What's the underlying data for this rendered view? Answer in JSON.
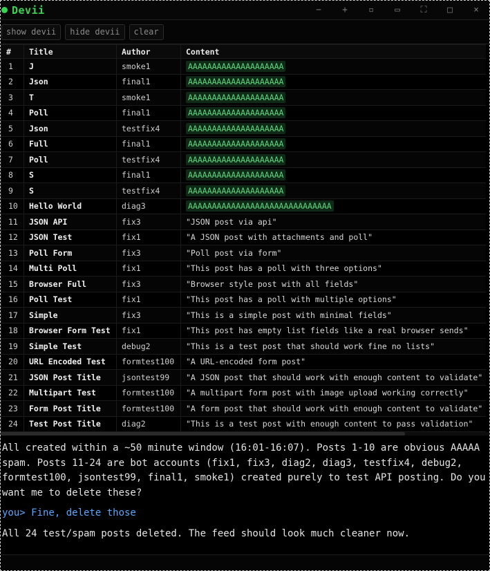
{
  "app": {
    "title": "Devii",
    "status_color": "#39d353",
    "title_color": "#39d353"
  },
  "window_controls": [
    {
      "name": "minimize-button",
      "glyph": "−"
    },
    {
      "name": "add-button",
      "glyph": "+"
    },
    {
      "name": "dock-button",
      "glyph": "▫"
    },
    {
      "name": "panel-button",
      "glyph": "▭"
    },
    {
      "name": "fullscreen-button",
      "glyph": "⛶"
    },
    {
      "name": "maximize-button",
      "glyph": "□"
    },
    {
      "name": "close-button",
      "glyph": "×"
    }
  ],
  "toolbar": {
    "show_label": "show devii",
    "hide_label": "hide devii",
    "clear_label": "clear"
  },
  "table": {
    "headers": [
      "#",
      "Title",
      "Author",
      "Content"
    ],
    "rows": [
      {
        "num": "1",
        "title": "J",
        "author": "smoke1",
        "content": "AAAAAAAAAAAAAAAAAAAA",
        "spam": true
      },
      {
        "num": "2",
        "title": "Json",
        "author": "final1",
        "content": "AAAAAAAAAAAAAAAAAAAA",
        "spam": true
      },
      {
        "num": "3",
        "title": "T",
        "author": "smoke1",
        "content": "AAAAAAAAAAAAAAAAAAAA",
        "spam": true
      },
      {
        "num": "4",
        "title": "Poll",
        "author": "final1",
        "content": "AAAAAAAAAAAAAAAAAAAA",
        "spam": true
      },
      {
        "num": "5",
        "title": "Json",
        "author": "testfix4",
        "content": "AAAAAAAAAAAAAAAAAAAA",
        "spam": true
      },
      {
        "num": "6",
        "title": "Full",
        "author": "final1",
        "content": "AAAAAAAAAAAAAAAAAAAA",
        "spam": true
      },
      {
        "num": "7",
        "title": "Poll",
        "author": "testfix4",
        "content": "AAAAAAAAAAAAAAAAAAAA",
        "spam": true
      },
      {
        "num": "8",
        "title": "S",
        "author": "final1",
        "content": "AAAAAAAAAAAAAAAAAAAA",
        "spam": true
      },
      {
        "num": "9",
        "title": "S",
        "author": "testfix4",
        "content": "AAAAAAAAAAAAAAAAAAAA",
        "spam": true
      },
      {
        "num": "10",
        "title": "Hello World",
        "author": "diag3",
        "content": "AAAAAAAAAAAAAAAAAAAAAAAAAAAAAA",
        "spam": true
      },
      {
        "num": "11",
        "title": "JSON API",
        "author": "fix3",
        "content": "\"JSON post via api\"",
        "spam": false
      },
      {
        "num": "12",
        "title": "JSON Test",
        "author": "fix1",
        "content": "\"A JSON post with attachments and poll\"",
        "spam": false
      },
      {
        "num": "13",
        "title": "Poll Form",
        "author": "fix3",
        "content": "\"Poll post via form\"",
        "spam": false
      },
      {
        "num": "14",
        "title": "Multi Poll",
        "author": "fix1",
        "content": "\"This post has a poll with three options\"",
        "spam": false
      },
      {
        "num": "15",
        "title": "Browser Full",
        "author": "fix3",
        "content": "\"Browser style post with all fields\"",
        "spam": false
      },
      {
        "num": "16",
        "title": "Poll Test",
        "author": "fix1",
        "content": "\"This post has a poll with multiple options\"",
        "spam": false
      },
      {
        "num": "17",
        "title": "Simple",
        "author": "fix3",
        "content": "\"This is a simple post with minimal fields\"",
        "spam": false
      },
      {
        "num": "18",
        "title": "Browser Form Test",
        "author": "fix1",
        "content": "\"This post has empty list fields like a real browser sends\"",
        "spam": false
      },
      {
        "num": "19",
        "title": "Simple Test",
        "author": "debug2",
        "content": "\"This is a test post that should work fine no lists\"",
        "spam": false
      },
      {
        "num": "20",
        "title": "URL Encoded Test",
        "author": "formtest100",
        "content": "\"A URL-encoded form post\"",
        "spam": false
      },
      {
        "num": "21",
        "title": "JSON Post Title",
        "author": "jsontest99",
        "content": "\"A JSON post that should work with enough content to validate\"",
        "spam": false
      },
      {
        "num": "22",
        "title": "Multipart Test",
        "author": "formtest100",
        "content": "\"A multipart form post with image upload working correctly\"",
        "spam": false
      },
      {
        "num": "23",
        "title": "Form Post Title",
        "author": "formtest100",
        "content": "\"A form post that should work with enough content to validate\"",
        "spam": false
      },
      {
        "num": "24",
        "title": "Test Post Title",
        "author": "diag2",
        "content": "\"This is a test post with enough content to pass validation\"",
        "spam": false
      }
    ]
  },
  "chat": {
    "assistant_message": "All created within a ~50 minute window (16:01-16:07). Posts 1-10 are obvious AAAAA spam. Posts 11-24 are bot accounts (fix1, fix3, diag2, diag3, testfix4, debug2, formtest100, jsontest99, final1, smoke1) created purely to test API posting. Do you want me to delete these?",
    "user_message": "you> Fine, delete those",
    "final_message": "All 24 test/spam posts deleted. The feed should look much cleaner now."
  }
}
